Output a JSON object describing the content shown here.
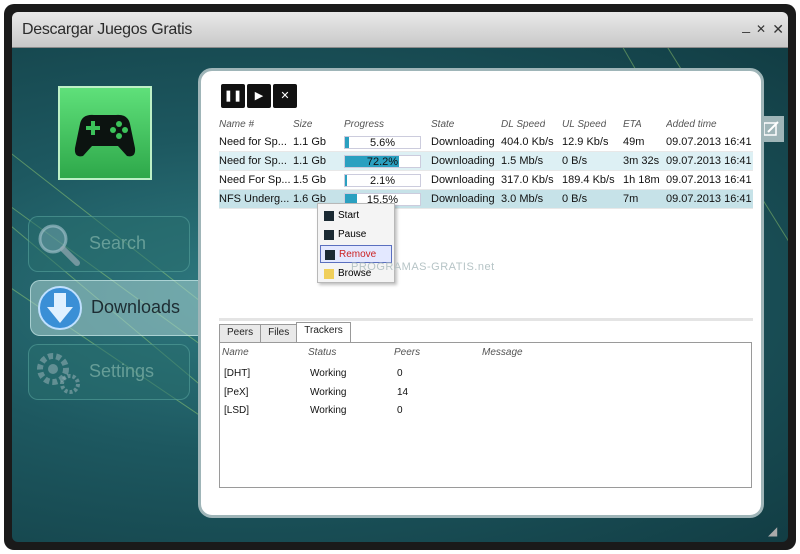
{
  "window": {
    "title": "Descargar Juegos Gratis",
    "controls": [
      "_",
      "✕",
      "✕"
    ]
  },
  "logo": {
    "icon": "gamepad-icon"
  },
  "nav": [
    {
      "label": "Search",
      "icon": "magnifier-icon",
      "active": false
    },
    {
      "label": "Downloads",
      "icon": "download-arrow-icon",
      "active": true
    },
    {
      "label": "Settings",
      "icon": "gears-icon",
      "active": false
    }
  ],
  "toolbar": {
    "buttons": [
      "pause",
      "play",
      "stop"
    ]
  },
  "columns": [
    "Name #",
    "Size",
    "Progress",
    "State",
    "DL Speed",
    "UL Speed",
    "ETA",
    "Added time"
  ],
  "downloads": [
    {
      "name": "Need for Sp...",
      "size": "1.1 Gb",
      "progress": 5.6,
      "progress_text": "5.6%",
      "state": "Downloading",
      "dl": "404.0 Kb/s",
      "ul": "12.9 Kb/s",
      "eta": "49m",
      "added": "09.07.2013 16:41"
    },
    {
      "name": "Need for Sp...",
      "size": "1.1 Gb",
      "progress": 72.2,
      "progress_text": "72.2%",
      "state": "Downloading",
      "dl": "1.5 Mb/s",
      "ul": "0 B/s",
      "eta": "3m 32s",
      "added": "09.07.2013 16:41"
    },
    {
      "name": "Need For Sp...",
      "size": "1.5 Gb",
      "progress": 2.1,
      "progress_text": "2.1%",
      "state": "Downloading",
      "dl": "317.0 Kb/s",
      "ul": "189.4 Kb/s",
      "eta": "1h 18m",
      "added": "09.07.2013 16:41"
    },
    {
      "name": "NFS Underg...",
      "size": "1.6 Gb",
      "progress": 15.5,
      "progress_text": "15.5%",
      "state": "Downloading",
      "dl": "3.0 Mb/s",
      "ul": "0 B/s",
      "eta": "7m",
      "added": "09.07.2013 16:41"
    }
  ],
  "context_menu": [
    "Start",
    "Pause",
    "Remove",
    "Browse"
  ],
  "watermark": "PROGRAMAS-GRATIS.net",
  "tabs": [
    "Peers",
    "Files",
    "Trackers"
  ],
  "active_tab": "Trackers",
  "tracker_columns": [
    "Name",
    "Status",
    "Peers",
    "Message"
  ],
  "trackers": [
    {
      "name": "[DHT]",
      "status": "Working",
      "peers": "0"
    },
    {
      "name": "[PeX]",
      "status": "Working",
      "peers": "14"
    },
    {
      "name": "[LSD]",
      "status": "Working",
      "peers": "0"
    }
  ],
  "colors": {
    "accent": "#2aa0c0",
    "logo": "#3cc25a",
    "background": "#1d5860"
  }
}
